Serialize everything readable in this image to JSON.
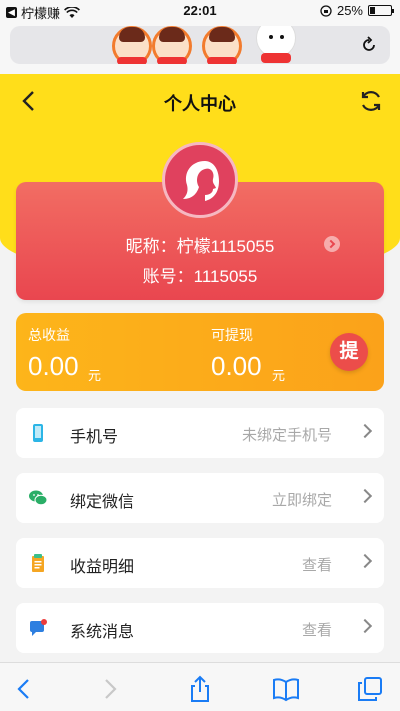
{
  "status_bar": {
    "app_back_label": "柠檬赚",
    "time": "22:01",
    "battery_percent": "25%",
    "battery_level": 0.25
  },
  "header": {
    "title": "个人中心"
  },
  "profile": {
    "nickname_label": "昵称：柠檬1115055",
    "account_label": "账号：1115055"
  },
  "earnings": {
    "total_label": "总收益",
    "total_value": "0.00",
    "total_unit": "元",
    "withdrawable_label": "可提现",
    "withdrawable_value": "0.00",
    "withdrawable_unit": "元",
    "withdraw_button": "提"
  },
  "menu": [
    {
      "label": "手机号",
      "value": "未绑定手机号",
      "icon": "phone-icon"
    },
    {
      "label": "绑定微信",
      "value": "立即绑定",
      "icon": "wechat-icon"
    },
    {
      "label": "收益明细",
      "value": "查看",
      "icon": "receipt-icon"
    },
    {
      "label": "系统消息",
      "value": "查看",
      "icon": "message-icon"
    }
  ],
  "colors": {
    "header_yellow": "#ffde1a",
    "profile_red": "#e9464f",
    "earnings_orange": "#fba21a"
  }
}
